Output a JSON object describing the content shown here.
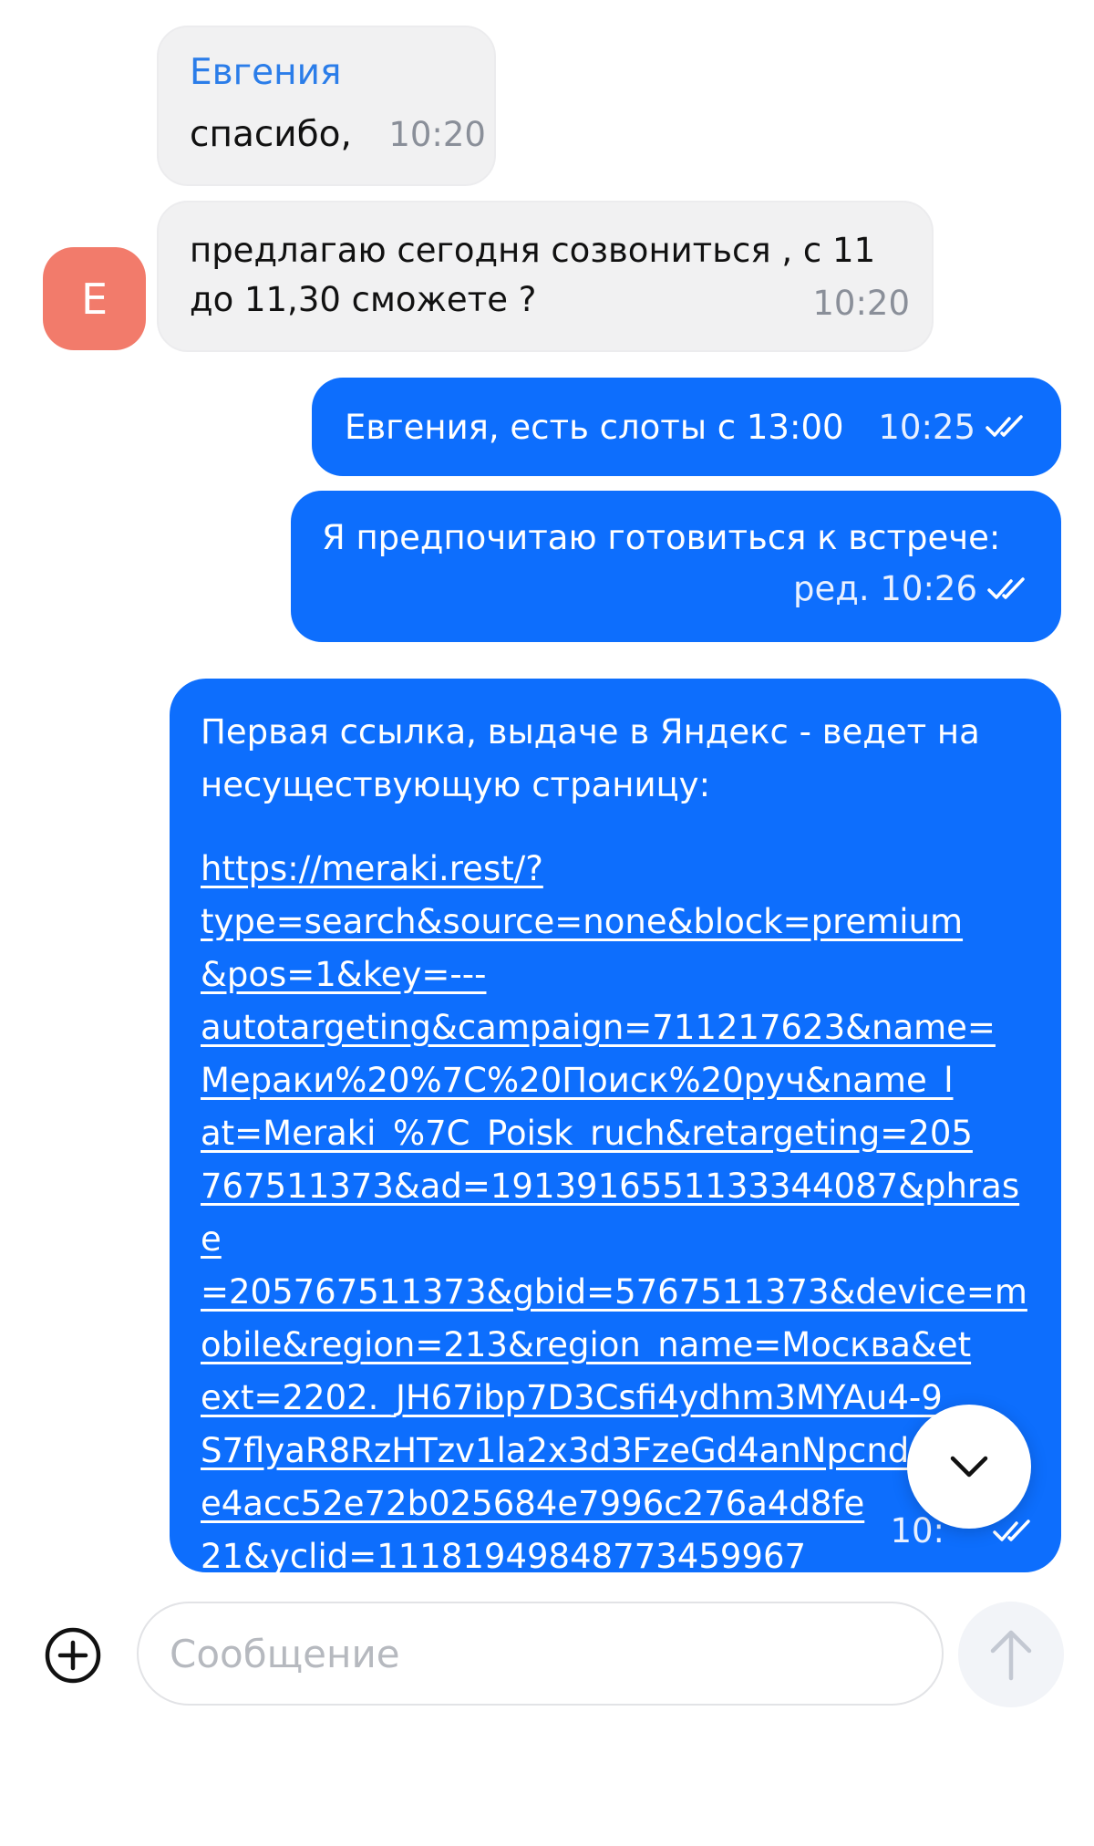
{
  "messages": {
    "m1": {
      "sender": "Евгения",
      "text": "спасибо,",
      "time": "10:20"
    },
    "m2": {
      "avatar_letter": "Е",
      "line1": "предлагаю сегодня созвониться , с 11",
      "line2": "до 11,30 сможете ?",
      "time": "10:20"
    },
    "m3": {
      "text": "Евгения, есть слоты с 13:00",
      "time": "10:25"
    },
    "m4": {
      "text": "Я предпочитаю готовиться к встрече:",
      "meta": "ред. 10:26"
    },
    "m5": {
      "line1": "Первая ссылка, выдаче в Яндекс - ведет на",
      "line2": "несуществующую страницу:",
      "link": "https://meraki.rest/?\ntype=search&source=none&block=premium\n&pos=1&key=---\nautotargeting&campaign=711217623&name=\nМераки%20%7C%20Поиск%20руч&name_l\nat=Meraki_%7C_Poisk_ruch&retargeting=205\n767511373&ad=1913916551133344087&phrase\n=205767511373&gbid=5767511373&device=m\nobile&region=213&region_name=Москва&et\next=2202._JH67ibp7D3Csfi4ydhm3MYAu4-9\nS7flyaR8RzHTzv1la2x3d3FzeGd4anNpcnd6.d\ne4acc52e72b025684e7996c276a4d8fe\n21&yclid=11181949848773459967",
      "time": "10:"
    }
  },
  "composer": {
    "placeholder": "Сообщение"
  },
  "colors": {
    "outgoing": "#0d6efd",
    "incoming": "#f1f1f2",
    "sender_name": "#2b7de9",
    "avatar": "#f27b6b"
  },
  "icons": {
    "add": "plus-circle-icon",
    "send": "arrow-up-icon",
    "scroll": "chevron-down-icon",
    "read": "double-check-icon"
  }
}
